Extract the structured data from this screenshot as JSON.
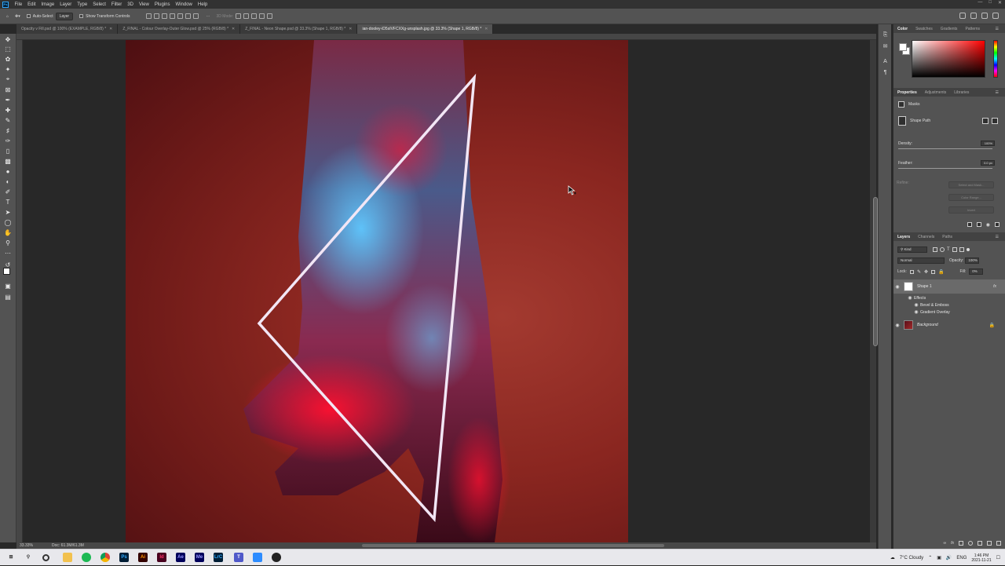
{
  "menu": {
    "items": [
      "File",
      "Edit",
      "Image",
      "Layer",
      "Type",
      "Select",
      "Filter",
      "3D",
      "View",
      "Plugins",
      "Window",
      "Help"
    ]
  },
  "options": {
    "auto_select_label": "Auto-Select",
    "auto_select_target": "Layer",
    "transform_controls_label": "Show Transform Controls",
    "mode_3d_label": "3D Mode:"
  },
  "tabs": [
    {
      "label": "Opacity v Fill.psd @ 100% (EXAMPLE, RGB/8) *",
      "active": false
    },
    {
      "label": "Z_FINAL - Colour Overlay-Outer Glow.psd @ 25% (RGB/8) *",
      "active": false
    },
    {
      "label": "Z_FINAL - Neon Shape.psd @ 33.3% (Shape 1, RGB/8) *",
      "active": false
    },
    {
      "label": "ian-dooley-iD5sIVFCXXg-unsplash.jpg @ 33.3% (Shape 1, RGB/8) *",
      "active": true
    }
  ],
  "status": {
    "zoom": "33.33%",
    "doc": "Doc: 61.3M/61.3M"
  },
  "color_panel": {
    "tabs": [
      "Color",
      "Swatches",
      "Gradients",
      "Patterns"
    ],
    "foreground": "#ffffff",
    "background": "#ffffff"
  },
  "properties_panel": {
    "tabs": [
      "Properties",
      "Adjustments",
      "Libraries"
    ],
    "section_label": "Masks",
    "shape_path_label": "Shape Path",
    "density_label": "Density:",
    "density_value": "100%",
    "feather_label": "Feather:",
    "feather_value": "0.0 px",
    "refine_label": "Refine:",
    "buttons": [
      "Select and Mask...",
      "Color Range...",
      "Invert"
    ]
  },
  "layers_panel": {
    "tabs": [
      "Layers",
      "Channels",
      "Paths"
    ],
    "filter_kind": "Kind",
    "blend_mode": "Normal",
    "opacity_label": "Opacity:",
    "opacity_value": "100%",
    "lock_label": "Lock:",
    "fill_label": "Fill:",
    "fill_value": "0%",
    "layers": [
      {
        "name": "Shape 1",
        "has_fx": true,
        "fx_label": "fx"
      },
      {
        "name": "Background",
        "locked": true
      }
    ],
    "effects_label": "Effects",
    "effects": [
      "Bevel & Emboss",
      "Gradient Overlay"
    ]
  },
  "taskbar": {
    "weather": "7°C  Cloudy",
    "language": "ENG",
    "time": "1:46 PM",
    "date": "2021-11-21"
  },
  "colors": {
    "accent": "#31a8ff",
    "canvas_bg": "#8a2620",
    "triangle_stroke": "#f2e6f5"
  }
}
